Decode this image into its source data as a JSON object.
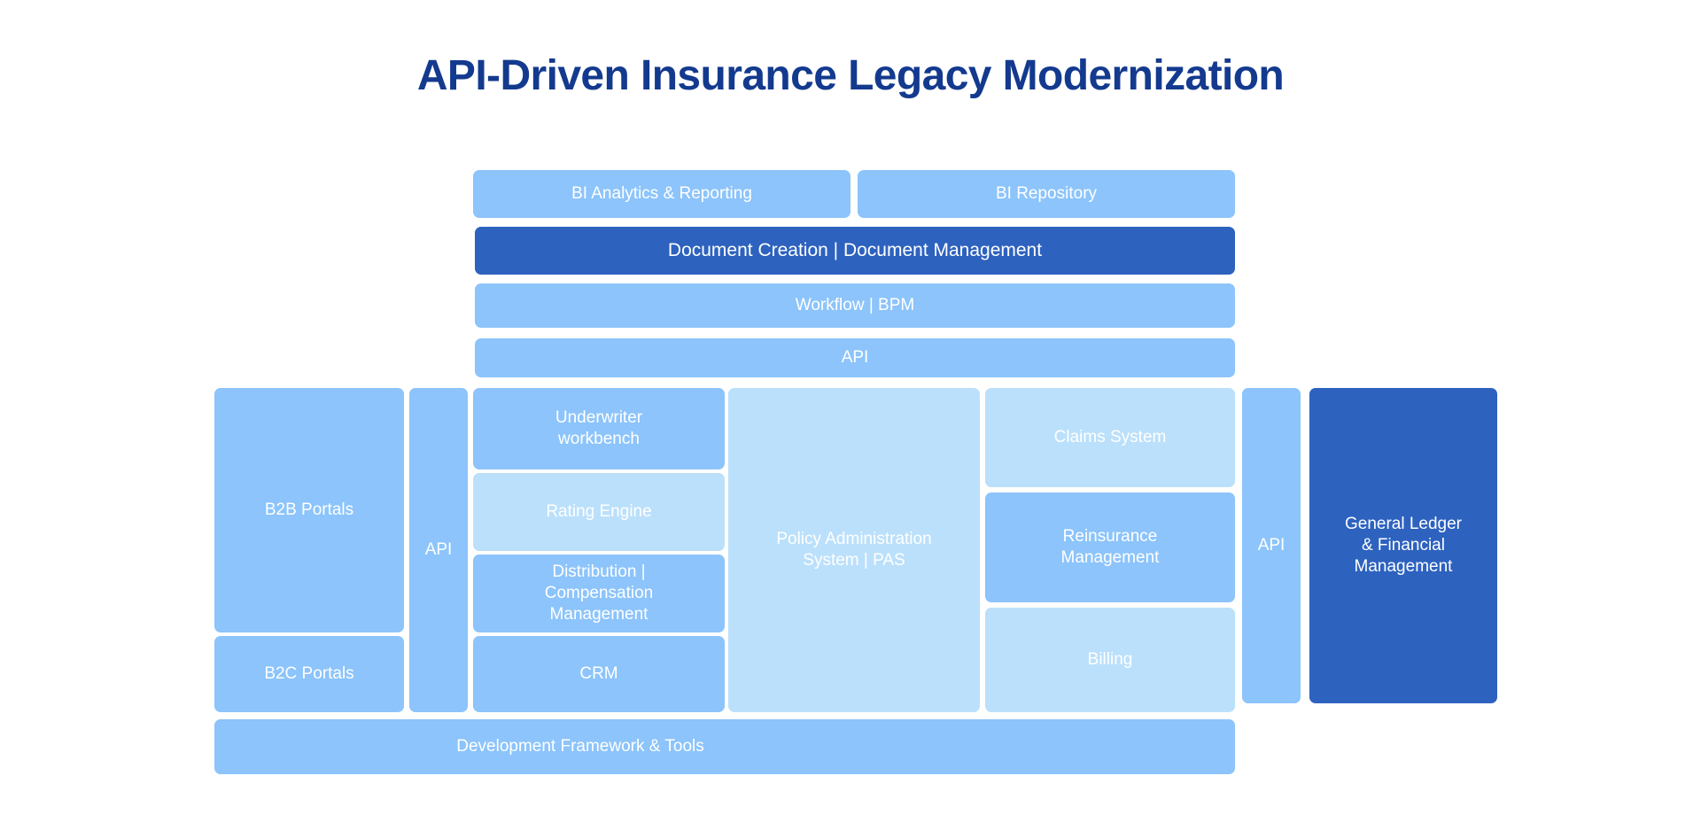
{
  "title": "API-Driven Insurance Legacy Modernization",
  "colors": {
    "title": "#133a8e",
    "mid_blue": "#8cc4fb",
    "light_blue": "#bbe0fb",
    "dark_blue": "#2d62bf",
    "label_text": "#ffffff",
    "background": "#ffffff"
  },
  "layers": {
    "bi_row": {
      "analytics": "BI Analytics & Reporting",
      "repository": "BI Repository"
    },
    "document_band": "Document Creation | Document Management",
    "workflow_band": "Workflow | BPM",
    "api_band": "API",
    "bottom_band": "Development Framework & Tools"
  },
  "columns": {
    "portals": {
      "b2b": "B2B Portals",
      "b2c": "B2C Portals"
    },
    "left_api": "API",
    "front_office": {
      "underwriter": "Underwriter\nworkbench",
      "rating_engine": "Rating Engine",
      "distribution": "Distribution |\nCompensation\nManagement",
      "crm": "CRM"
    },
    "core": {
      "pas": "Policy Administration\nSystem | PAS"
    },
    "back_office": {
      "claims": "Claims System",
      "reinsurance": "Reinsurance\nManagement",
      "billing": "Billing"
    },
    "right_api": "API",
    "finance": "General Ledger\n& Financial\nManagement"
  }
}
